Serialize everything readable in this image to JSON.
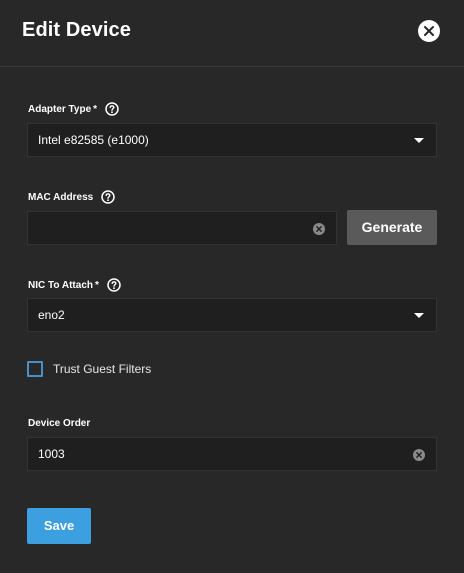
{
  "dialog": {
    "title": "Edit Device"
  },
  "form": {
    "adapter_type": {
      "label": "Adapter Type",
      "required_mark": "*",
      "value": "Intel e82585 (e1000)"
    },
    "mac_address": {
      "label": "MAC Address",
      "value": "",
      "generate_label": "Generate"
    },
    "nic_to_attach": {
      "label": "NIC To Attach",
      "required_mark": "*",
      "value": "eno2"
    },
    "trust_guest_filters": {
      "label": "Trust Guest Filters",
      "checked": false
    },
    "device_order": {
      "label": "Device Order",
      "value": "1003"
    },
    "save_label": "Save"
  },
  "colors": {
    "background": "#282828",
    "field_background": "#1f1f1f",
    "primary_button": "#3b9fe0",
    "secondary_button": "#5a5a5a",
    "checkbox_border": "#4a90c8"
  }
}
